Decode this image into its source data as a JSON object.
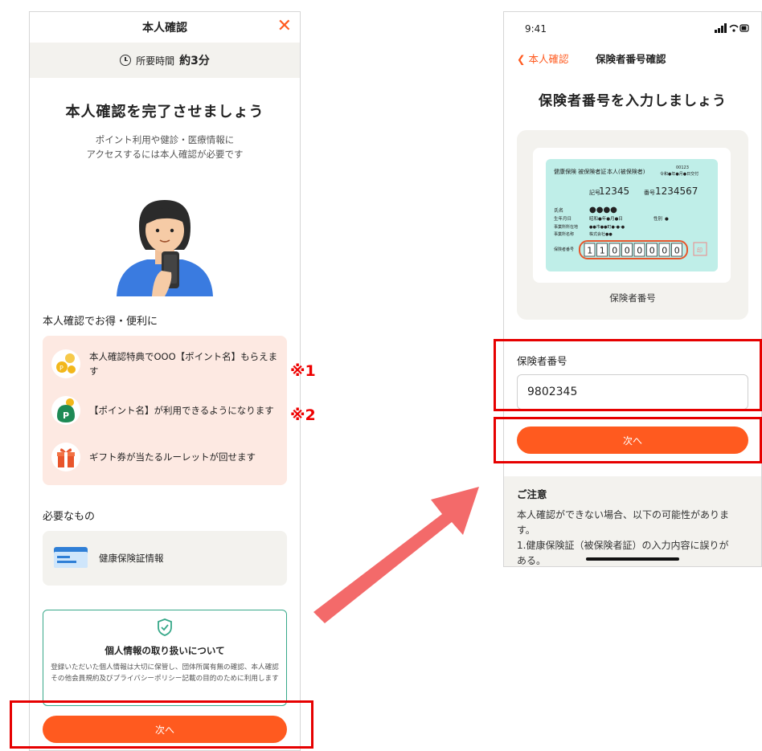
{
  "left": {
    "header_title": "本人確認",
    "close_glyph": "✕",
    "time_label": "所要時間",
    "time_value": "約3分",
    "headline": "本人確認を完了させましょう",
    "sub_line1": "ポイント利用や健診・医療情報に",
    "sub_line2": "アクセスするには本人確認が必要です",
    "benefits_title": "本人確認でお得・便利に",
    "benefits": [
      {
        "icon": "coins-icon",
        "text": "本人確認特典でOOO【ポイント名】もらえます"
      },
      {
        "icon": "point-wallet-icon",
        "text": "【ポイント名】が利用できるようになります"
      },
      {
        "icon": "gift-icon",
        "text": "ギフト券が当たるルーレットが回せます"
      }
    ],
    "needs_title": "必要なもの",
    "need_item": "健康保険証情報",
    "privacy_title": "個人情報の取り扱いについて",
    "privacy_text": "登録いただいた個人情報は大切に保管し、団体所属有無の確認、本人確認その他会員規約及びプライバシーポリシー記載の目的のために利用します",
    "next_label": "次へ"
  },
  "notes": {
    "n1": "※1",
    "n2": "※2"
  },
  "right": {
    "status_time": "9:41",
    "status_icons": "▪▪▪ ᯤ ▭",
    "back_label": "本人確認",
    "nav_title": "保険者番号確認",
    "title": "保険者番号を入力しましょう",
    "card": {
      "heading_left": "健康保険 被保険者証",
      "heading_mid": "本人(被保険者)",
      "issue": "令和●年●月●日交付",
      "number_code": "00123",
      "kigo_label": "記号",
      "kigo": "12345",
      "bango_label": "番号",
      "bango": "1234567",
      "name_label": "氏名",
      "name_value": "●●●●",
      "birth_label": "生年月日",
      "birth_value": "昭和●年●月●日",
      "sex_label": "性別",
      "sex_value": "●",
      "office_addr_label": "事業所所在地",
      "office_addr_value": "●●市●●町●-●-●",
      "office_name_label": "事業所名称",
      "office_name_value": "株式会社●●",
      "insurer_label": "保険者番号",
      "insurer_digits": [
        "1",
        "1",
        "0",
        "0",
        "0",
        "0",
        "0",
        "0"
      ],
      "seal": "印"
    },
    "card_caption": "保険者番号",
    "form_label": "保険者番号",
    "form_value": "9802345",
    "next_label": "次へ",
    "notice_title": "ご注意",
    "notice_line1": "本人確認ができない場合、以下の可能性がありま",
    "notice_line2": "す。",
    "notice_line3": "1.健康保険証（被保険者証）の入力内容に誤りが",
    "notice_line4": "ある。"
  },
  "colors": {
    "accent": "#ff5a1f",
    "highlight": "#e60000",
    "arrow": "#f36a6a",
    "card": "#bfeee8"
  }
}
